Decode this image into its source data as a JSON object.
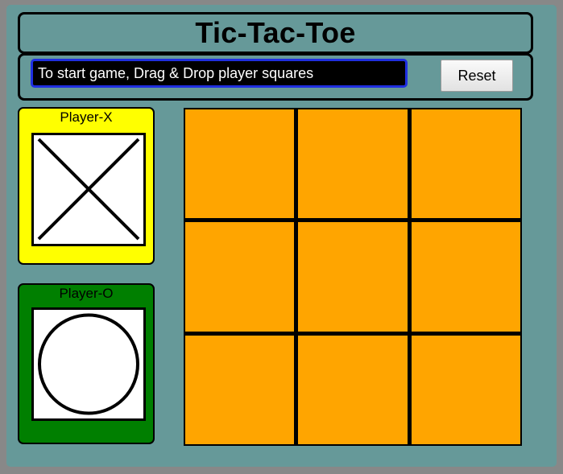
{
  "header": {
    "title": "Tic-Tac-Toe"
  },
  "controls": {
    "status_message": "To start game, Drag & Drop player squares",
    "reset_label": "Reset",
    "status_field_color": "#000000",
    "status_border_color": "#1f2fe0"
  },
  "players": [
    {
      "label": "Player-X",
      "mark": "x-mark-icon",
      "card_color": "#ffff00"
    },
    {
      "label": "Player-O",
      "mark": "o-mark-icon",
      "card_color": "#007f00"
    }
  ],
  "board": {
    "rows": 3,
    "cols": 3,
    "cell_color": "#ffa500",
    "cells": [
      "",
      "",
      "",
      "",
      "",
      "",
      "",
      "",
      ""
    ]
  },
  "colors": {
    "background": "#669999"
  }
}
